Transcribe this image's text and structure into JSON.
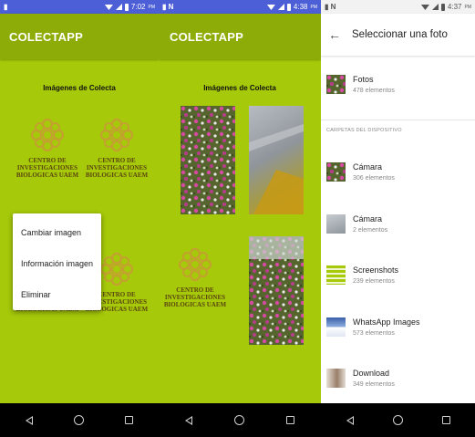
{
  "screens": [
    {
      "status_time": "7:02",
      "status_ampm": "PM",
      "app_title": "COLECTAPP",
      "section_title": "Imágenes de Colecta",
      "logo_text": "CENTRO DE INVESTIGACIONES BIOLOGICAS UAEM",
      "context_menu": [
        "Cambiar imagen",
        "Información imagen",
        "Eliminar"
      ]
    },
    {
      "status_time": "4:38",
      "status_ampm": "PM",
      "app_title": "COLECTAPP",
      "section_title": "Imágenes de Colecta",
      "logo_text": "CENTRO DE INVESTIGACIONES BIOLOGICAS UAEM"
    },
    {
      "status_time": "4:37",
      "status_ampm": "PM",
      "title": "Seleccionar una foto",
      "top_item": {
        "name": "Fotos",
        "count": "478 elementos",
        "icon": "photos-thumbnail"
      },
      "section_header": "CARPETAS DEL DISPOSITIVO",
      "folders": [
        {
          "name": "Cámara",
          "count": "306 elementos",
          "icon": "flower-thumbnail"
        },
        {
          "name": "Cámara",
          "count": "2 elementos",
          "icon": "camera-thumbnail"
        },
        {
          "name": "Screenshots",
          "count": "239 elementos",
          "icon": "screenshot-thumbnail"
        },
        {
          "name": "WhatsApp Images",
          "count": "573 elementos",
          "icon": "whatsapp-thumbnail"
        },
        {
          "name": "Download",
          "count": "349 elementos",
          "icon": "download-thumbnail"
        }
      ]
    }
  ],
  "colors": {
    "app_background": "#a6c909",
    "app_bar": "#8eac07",
    "status_bar": "#4d5fd6",
    "logo": "#c4a030"
  }
}
